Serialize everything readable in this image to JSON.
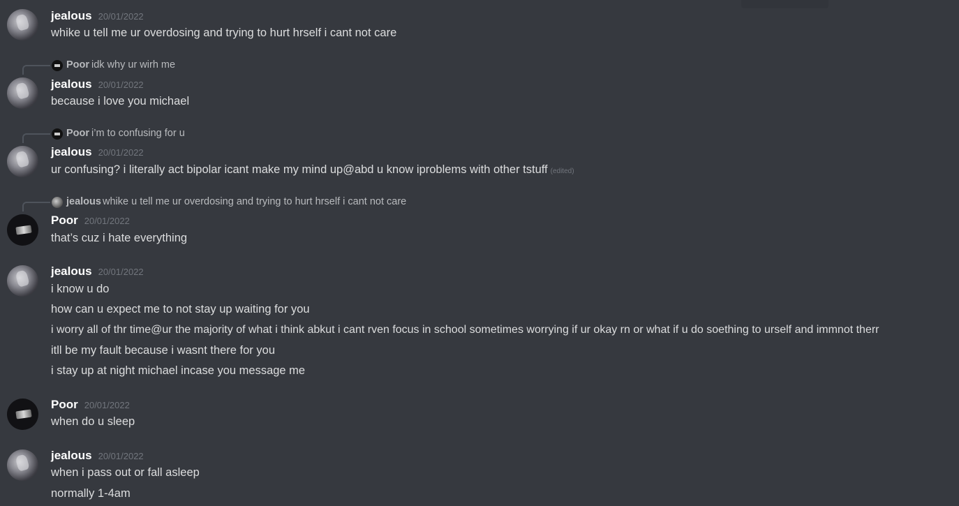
{
  "messages": [
    {
      "author": "jealous",
      "timestamp": "20/01/2022",
      "lines": [
        "whike u tell me ur overdosing and trying to hurt hrself i cant not care"
      ]
    },
    {
      "reply": {
        "author": "Poor",
        "text": "idk why ur wirh me"
      },
      "author": "jealous",
      "timestamp": "20/01/2022",
      "lines": [
        "because i love you michael"
      ]
    },
    {
      "reply": {
        "author": "Poor",
        "text": "i’m to confusing for u"
      },
      "author": "jealous",
      "timestamp": "20/01/2022",
      "lines": [
        "ur confusing? i literally act bipolar icant make my mind up@abd  u know iproblems with other tstuff"
      ],
      "edited": "(edited)"
    },
    {
      "reply": {
        "author": "jealous",
        "text": "whike u tell me ur overdosing and trying to hurt hrself i cant not care"
      },
      "author": "Poor",
      "timestamp": "20/01/2022",
      "lines": [
        "that’s cuz i hate everything"
      ]
    },
    {
      "author": "jealous",
      "timestamp": "20/01/2022",
      "lines": [
        "i know u do",
        "how can u expect me to not stay up waiting for you",
        "i worry all of thr time@ur the majority of what i think abkut i cant rven focus in school sometimes worrying if ur okay rn or what if u do soething to urself and immnot therr",
        "itll be my fault because i wasnt there for you",
        "i stay up at night michael incase you message me"
      ]
    },
    {
      "author": "Poor",
      "timestamp": "20/01/2022",
      "lines": [
        "when do u sleep"
      ]
    },
    {
      "author": "jealous",
      "timestamp": "20/01/2022",
      "lines": [
        "when i pass out or fall asleep",
        "normally 1-4am"
      ]
    }
  ]
}
